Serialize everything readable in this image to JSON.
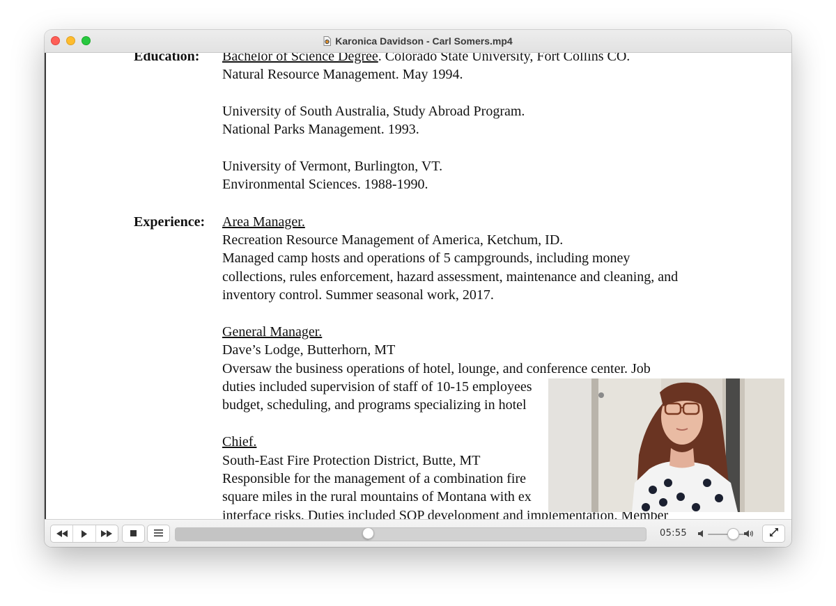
{
  "window": {
    "title": "Karonica Davidson - Carl Somers.mp4",
    "title_icon": "video-file-icon"
  },
  "document": {
    "labels": {
      "education": "Education:",
      "experience": "Experience:"
    },
    "lines": [
      {
        "text": "Bachelor of Science Degree",
        "underline": true,
        "suffix": ".  Colorado State University, Fort Collins CO."
      },
      {
        "text": "Natural Resource Management.  May 1994."
      },
      {
        "text": "University of South Australia, Study Abroad Program."
      },
      {
        "text": "National Parks Management.  1993."
      },
      {
        "text": "University of Vermont, Burlington, VT."
      },
      {
        "text": "Environmental Sciences.  1988-1990."
      },
      {
        "text": "Area Manager.",
        "underline": true
      },
      {
        "text": "Recreation Resource Management of America, Ketchum, ID."
      },
      {
        "text": "Managed camp hosts and operations of 5 campgrounds, including money"
      },
      {
        "text": "collections, rules enforcement, hazard assessment, maintenance and cleaning, and"
      },
      {
        "text": "inventory control. Summer seasonal work, 2017."
      },
      {
        "text": "General Manager.",
        "underline": true
      },
      {
        "text": "Dave’s Lodge, Butterhorn, MT"
      },
      {
        "text": "Oversaw the business operations of hotel, lounge, and conference center. Job"
      },
      {
        "text": "duties included supervision of staff of 10-15 employees"
      },
      {
        "text": "budget, scheduling, and programs specializing in hotel"
      },
      {
        "text": "Chief.",
        "underline": true
      },
      {
        "text": "South-East Fire Protection District, Butte, MT"
      },
      {
        "text": "Responsible for the management of a combination fire"
      },
      {
        "text": "square miles in the rural mountains of Montana with ex"
      },
      {
        "text": "interface risks. Duties included SOP development and implementation. Member"
      }
    ]
  },
  "controls": {
    "rewind_icon": "rewind-icon",
    "play_icon": "play-icon",
    "fast_forward_icon": "fast-forward-icon",
    "stop_icon": "stop-icon",
    "playlist_icon": "playlist-icon",
    "elapsed_time": "05:55",
    "progress_fraction": 0.41,
    "volume_fraction": 0.7,
    "volume_low_icon": "volume-low-icon",
    "volume_high_icon": "volume-high-icon",
    "fullscreen_icon": "fullscreen-icon"
  },
  "colors": {
    "close": "#fe5f57",
    "minimize": "#febc2e",
    "maximize": "#28c840"
  }
}
